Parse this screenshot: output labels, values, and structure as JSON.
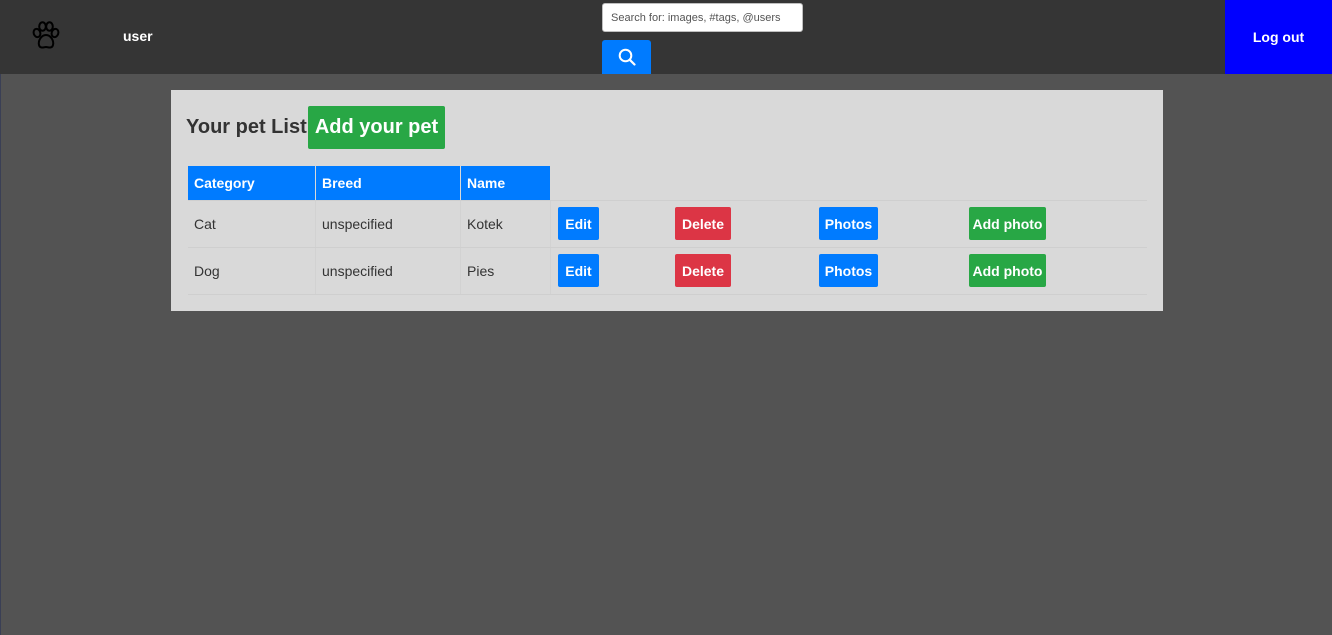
{
  "navbar": {
    "logo_icon": "paw-icon",
    "username": "user",
    "search": {
      "placeholder": "Search for: images, #tags, @users",
      "value": "",
      "button_icon": "search-icon"
    },
    "logout_label": "Log out"
  },
  "panel": {
    "title": "Your pet List",
    "add_pet_label": "Add your pet"
  },
  "table": {
    "headers": [
      "Category",
      "Breed",
      "Name"
    ],
    "rows": [
      {
        "category": "Cat",
        "breed": "unspecified",
        "name": "Kotek",
        "edit_label": "Edit",
        "delete_label": "Delete",
        "photos_label": "Photos",
        "add_photo_label": "Add photo"
      },
      {
        "category": "Dog",
        "breed": "unspecified",
        "name": "Pies",
        "edit_label": "Edit",
        "delete_label": "Delete",
        "photos_label": "Photos",
        "add_photo_label": "Add photo"
      }
    ]
  },
  "colors": {
    "navbar_bg": "#353535",
    "page_bg": "#535353",
    "panel_bg": "#d9d9d9",
    "primary": "#007bff",
    "danger": "#dc3545",
    "success": "#28a745",
    "logout_bg": "#0000ff"
  }
}
